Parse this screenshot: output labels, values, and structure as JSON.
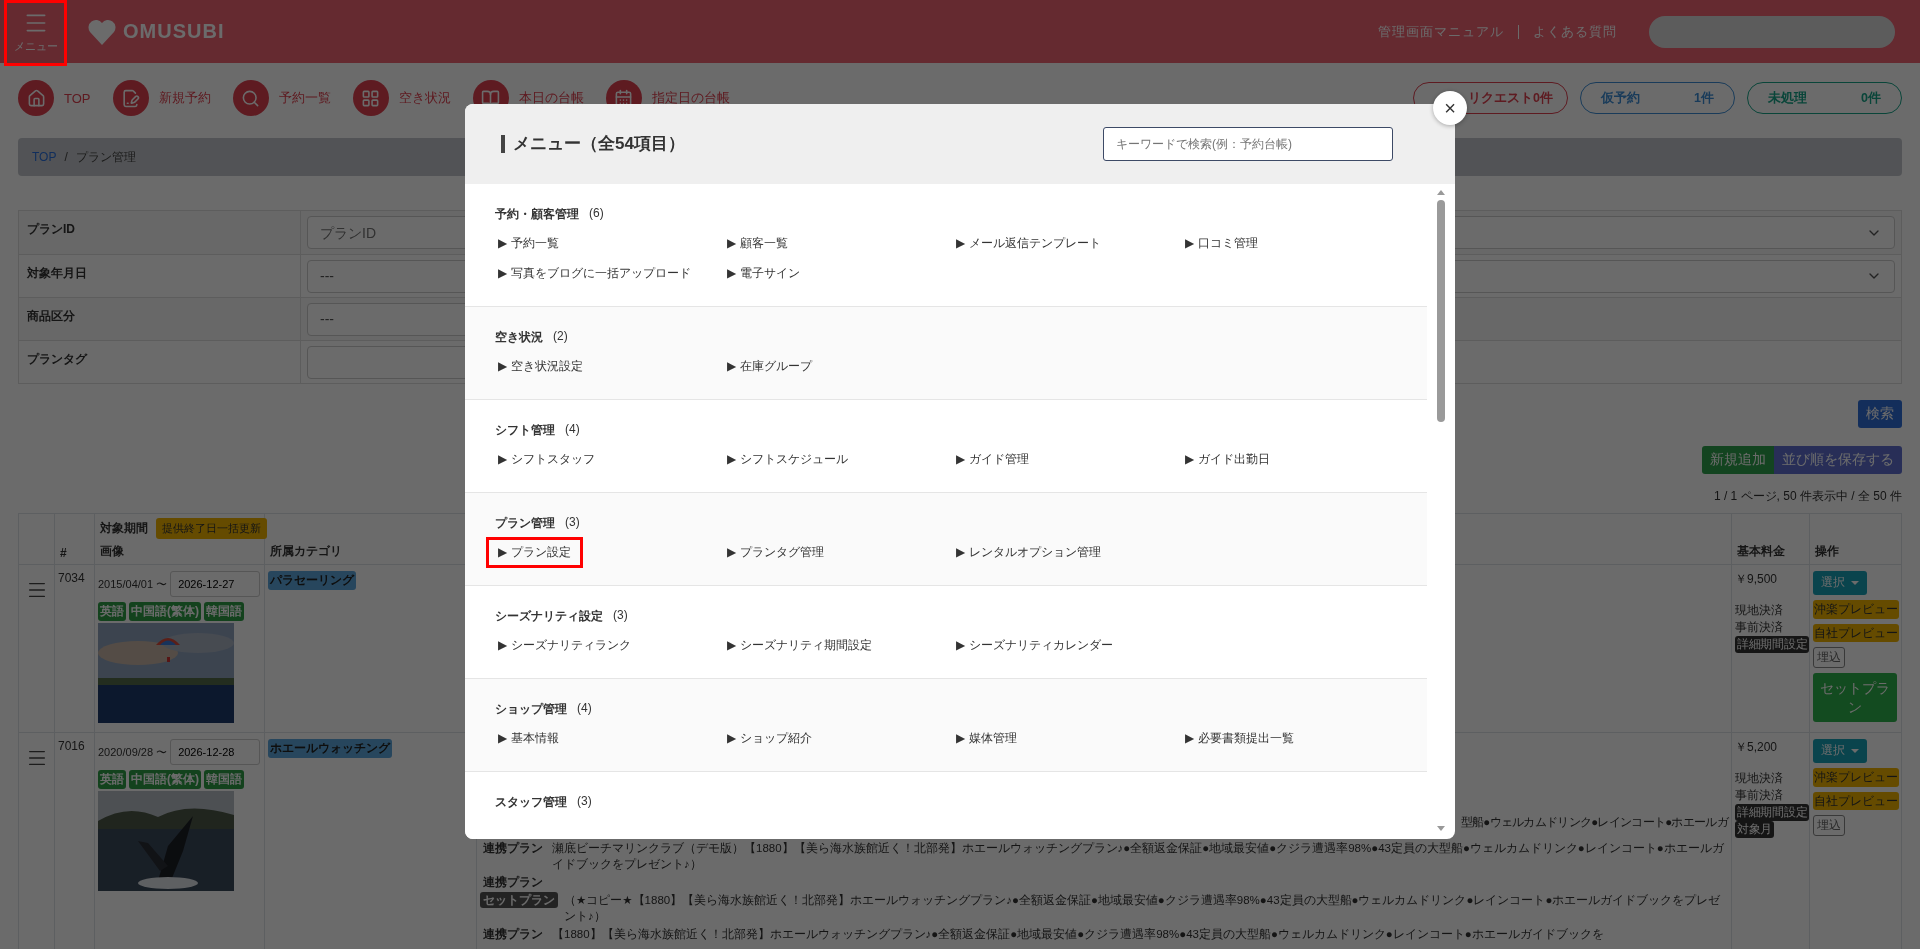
{
  "header": {
    "menu_button": {
      "label": "メニュー",
      "highlighted": true
    },
    "logo": "OMUSUBI",
    "links": [
      "管理画面マニュアル",
      "よくある質問"
    ]
  },
  "nav": [
    {
      "label": "TOP"
    },
    {
      "label": "新規予約"
    },
    {
      "label": "予約一覧"
    },
    {
      "label": "空き状況"
    },
    {
      "label": "本日の台帳"
    },
    {
      "label": "指定日の台帳"
    }
  ],
  "status_pills": [
    {
      "label": "リクエスト",
      "count": "0件"
    },
    {
      "label": "仮予約",
      "count": "1件"
    },
    {
      "label": "未処理",
      "count": "0件"
    }
  ],
  "breadcrumb": {
    "items": [
      "TOP",
      "プラン管理"
    ],
    "separator": "/"
  },
  "filters": [
    {
      "label": "プランID",
      "kind": "input",
      "placeholder": "プランID",
      "side_select": true
    },
    {
      "label": "対象年月日",
      "kind": "select",
      "value": "---",
      "side_select": true
    },
    {
      "label": "商品区分",
      "kind": "select",
      "value": "---",
      "side_select": false
    },
    {
      "label": "プランタグ",
      "kind": "input",
      "side_select": false
    }
  ],
  "search_button": "検索",
  "add_button": "新規追加",
  "save_order_button": "並び順を保存する",
  "pagination": "1 / 1 ページ, 50 件表示中 / 全 50 件",
  "table": {
    "number": "#",
    "period": "対象期間",
    "bulk_button": "提供終了日一括更新",
    "image": "画像",
    "category": "所属カテゴリ",
    "price": "基本料金",
    "actions": "操作",
    "rows": [
      {
        "id": "7034",
        "start": "2015/04/01 〜",
        "end": "2026-12-27",
        "languages": [
          "英語",
          "中国語(繁体)",
          "韓国語"
        ],
        "category": "パラセーリング",
        "price": "￥9,500",
        "payments": [
          "現地決済",
          "事前決済"
        ],
        "badges": [
          "詳細期間設定"
        ],
        "buttons": [
          {
            "kind": "dropdown",
            "label": "選択"
          },
          {
            "kind": "preview",
            "label": "沖楽プレビュー"
          },
          {
            "kind": "preview",
            "label": "自社プレビュー"
          },
          {
            "kind": "outline",
            "label": "埋込"
          },
          {
            "kind": "set_plan",
            "label": "セットプラン"
          }
        ]
      },
      {
        "id": "7016",
        "start": "2020/09/28 〜",
        "end": "2026-12-28",
        "languages": [
          "英語",
          "中国語(繁体)",
          "韓国語"
        ],
        "category": "ホエールウォッチング",
        "price": "￥5,200",
        "payments": [
          "現地決済",
          "事前決済"
        ],
        "badges": [
          "詳細期間設定",
          "対象月"
        ],
        "buttons": [
          {
            "kind": "dropdown",
            "label": "選択"
          },
          {
            "kind": "preview",
            "label": "沖楽プレビュー"
          },
          {
            "kind": "preview",
            "label": "自社プレビュー"
          },
          {
            "kind": "outline",
            "label": "埋込"
          }
        ],
        "cut_line": "型船●ウェルカムドリンク●レインコート●ホエールガ",
        "linked": [
          {
            "linked_badge": "連携プラン",
            "text": "瀬底ビーチマリンクラブ（デモ版）【1880】【美ら海水族館近く！北部発】ホエールウォッチングプラン♪●全額返金保証●地域最安値●クジラ遭遇率98%●43定員の大型船●ウェルカムドリンク●レインコート●ホエールガイドブックをプレゼント♪）"
          },
          {
            "linked_badge": "連携プラン"
          },
          {
            "set_badge": "セットプラン",
            "text": "（★コピー★【1880】【美ら海水族館近く！北部発】ホエールウォッチングプラン♪●全額返金保証●地域最安値●クジラ遭遇率98%●43定員の大型船●ウェルカムドリンク●レインコート●ホエールガイドブックをプレゼント♪）"
          },
          {
            "linked_badge": "連携プラン",
            "text": "【1880】【美ら海水族館近く！北部発】ホエールウォッチングプラン♪●全額返金保証●地域最安値●クジラ遭遇率98%●43定員の大型船●ウェルカムドリンク●レインコート●ホエールガイドブックを"
          }
        ]
      }
    ]
  },
  "modal": {
    "title": "メニュー（全54項目）",
    "search_placeholder": "キーワードで検索(例：予約台帳)",
    "close": "×",
    "sections": [
      {
        "title": "予約・顧客管理",
        "count": "(6)",
        "items": [
          {
            "label": "▶ 予約一覧",
            "highlighted": false
          },
          {
            "label": "▶ 顧客一覧",
            "highlighted": false
          },
          {
            "label": "▶ メール返信テンプレート",
            "highlighted": false
          },
          {
            "label": "▶ 口コミ管理",
            "highlighted": false
          },
          {
            "label": "▶ 写真をブログに一括アップロード",
            "highlighted": false
          },
          {
            "label": "▶ 電子サイン",
            "highlighted": false
          }
        ]
      },
      {
        "title": "空き状況",
        "count": "(2)",
        "items": [
          {
            "label": "▶ 空き状況設定",
            "highlighted": false
          },
          {
            "label": "▶ 在庫グループ",
            "highlighted": false
          }
        ]
      },
      {
        "title": "シフト管理",
        "count": "(4)",
        "items": [
          {
            "label": "▶ シフトスタッフ",
            "highlighted": false
          },
          {
            "label": "▶ シフトスケジュール",
            "highlighted": false
          },
          {
            "label": "▶ ガイド管理",
            "highlighted": false
          },
          {
            "label": "▶ ガイド出勤日",
            "highlighted": false
          }
        ]
      },
      {
        "title": "プラン管理",
        "count": "(3)",
        "items": [
          {
            "label": "▶ プラン設定",
            "highlighted": true
          },
          {
            "label": "▶ プランタグ管理",
            "highlighted": false
          },
          {
            "label": "▶ レンタルオプション管理",
            "highlighted": false
          }
        ]
      },
      {
        "title": "シーズナリティ設定",
        "count": "(3)",
        "items": [
          {
            "label": "▶ シーズナリティランク",
            "highlighted": false
          },
          {
            "label": "▶ シーズナリティ期間設定",
            "highlighted": false
          },
          {
            "label": "▶ シーズナリティカレンダー",
            "highlighted": false
          }
        ]
      },
      {
        "title": "ショップ管理",
        "count": "(4)",
        "items": [
          {
            "label": "▶ 基本情報",
            "highlighted": false
          },
          {
            "label": "▶ ショップ紹介",
            "highlighted": false
          },
          {
            "label": "▶ 媒体管理",
            "highlighted": false
          },
          {
            "label": "▶ 必要書類提出一覧",
            "highlighted": false
          }
        ]
      },
      {
        "title": "スタッフ管理",
        "count": "(3)"
      }
    ]
  }
}
